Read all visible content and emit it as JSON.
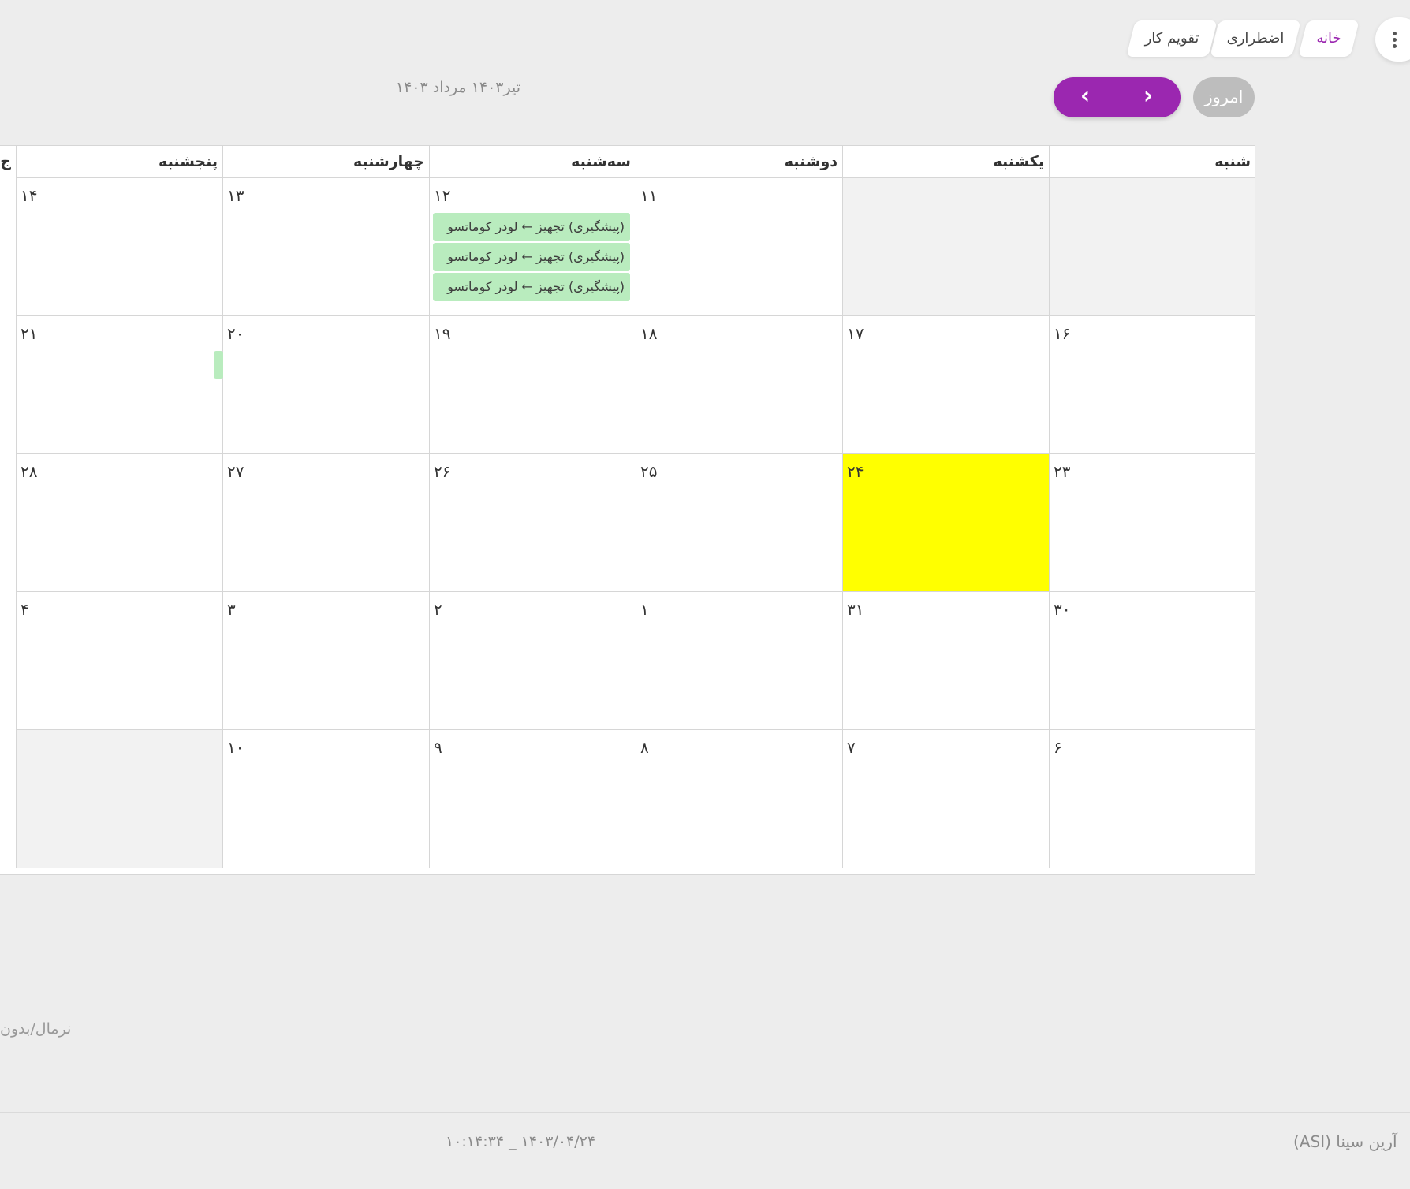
{
  "breadcrumb": {
    "items": [
      "خانه",
      "اضطراری",
      "تقویم کار"
    ]
  },
  "toolbar": {
    "today_label": "امروز",
    "prev_icon": "‹",
    "next_icon": "›",
    "period_title": "تیر۱۴۰۳ مرداد ۱۴۰۳",
    "more_icon": "more-vertical-icon"
  },
  "calendar": {
    "weekdays": [
      "شنبه",
      "یکشنبه",
      "دوشنبه",
      "سه‌شنبه",
      "چهارشنبه",
      "پنجشنبه",
      "ج"
    ],
    "weeks": [
      {
        "days": [
          {
            "num": "",
            "off": true
          },
          {
            "num": "",
            "off": true
          },
          {
            "num": "۱۱"
          },
          {
            "num": "۱۲",
            "events": [
              "(پیشگیری) تجهیز ← لودر کوماتسو",
              "(پیشگیری) تجهیز ← لودر کوماتسو",
              "(پیشگیری) تجهیز ← لودر کوماتسو"
            ]
          },
          {
            "num": "۱۳"
          },
          {
            "num": "۱۴"
          }
        ]
      },
      {
        "days": [
          {
            "num": "۱۶"
          },
          {
            "num": "۱۷"
          },
          {
            "num": "۱۸"
          },
          {
            "num": "۱۹"
          },
          {
            "num": "۲۰"
          },
          {
            "num": "۲۱",
            "partial_event": true
          }
        ]
      },
      {
        "days": [
          {
            "num": "۲۳"
          },
          {
            "num": "۲۴",
            "today": true
          },
          {
            "num": "۲۵"
          },
          {
            "num": "۲۶"
          },
          {
            "num": "۲۷"
          },
          {
            "num": "۲۸"
          }
        ]
      },
      {
        "days": [
          {
            "num": "۳۰"
          },
          {
            "num": "۳۱"
          },
          {
            "num": "۱"
          },
          {
            "num": "۲"
          },
          {
            "num": "۳"
          },
          {
            "num": "۴"
          }
        ]
      },
      {
        "days": [
          {
            "num": "۶"
          },
          {
            "num": "۷"
          },
          {
            "num": "۸"
          },
          {
            "num": "۹"
          },
          {
            "num": "۱۰"
          },
          {
            "num": "",
            "off": true
          }
        ]
      }
    ]
  },
  "legend": {
    "text": "نرمال/بدون"
  },
  "footer": {
    "datetime": "۱۰:۱۴:۳۴ _ ۱۴۰۳/۰۴/۲۴",
    "brand": "آرین سینا (ASI)"
  },
  "colors": {
    "accent": "#9b27b0",
    "today": "#ffff00",
    "event": "#b9ecbe",
    "off_day": "#f2f2f2"
  }
}
